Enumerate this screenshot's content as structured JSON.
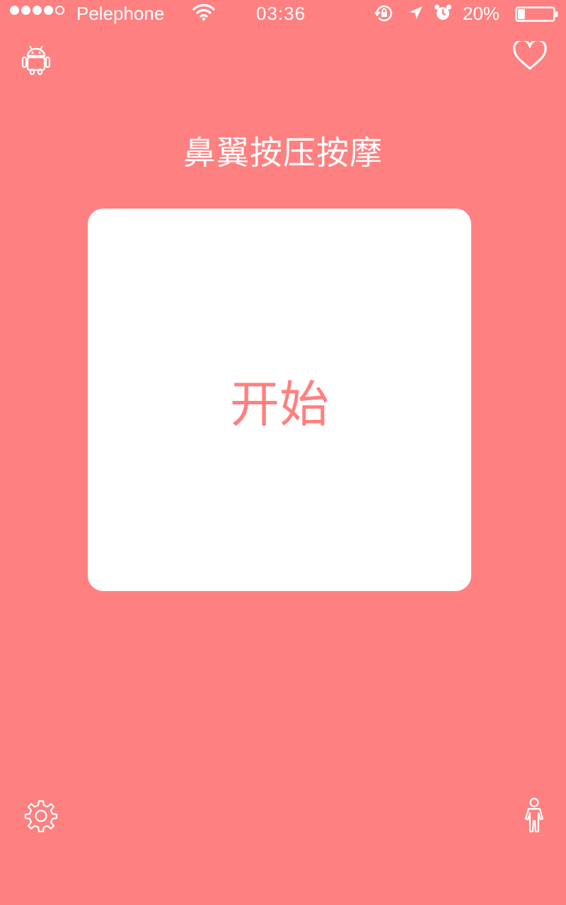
{
  "status_bar": {
    "signal_bars_filled": 4,
    "signal_bars_total": 5,
    "carrier": "Pelephone",
    "time": "03:36",
    "battery_percent": "20%",
    "battery_level": 0.2
  },
  "header": {
    "left_icon": "android-icon",
    "right_icon": "heart-icon"
  },
  "main": {
    "title": "鼻翼按压按摩",
    "start_label": "开始"
  },
  "footer": {
    "left_icon": "gear-icon",
    "right_icon": "person-icon"
  },
  "colors": {
    "background": "#FF8080",
    "card": "#FFFFFF",
    "accent_text": "#FF8080"
  }
}
